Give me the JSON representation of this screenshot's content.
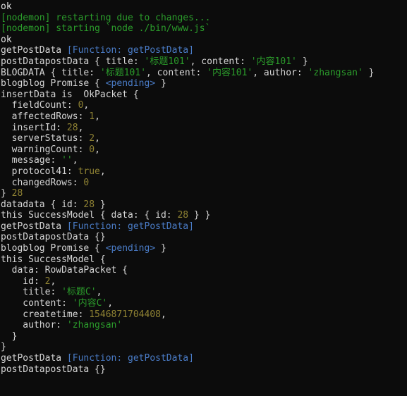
{
  "terminal": {
    "title": "node terminal output",
    "colors": {
      "background": "#0c0c0c",
      "default_text": "#d6d6d6",
      "string_green": "#2b9c2b",
      "function_blue": "#4a7cc7",
      "number_yellow": "#8f8233"
    },
    "lines": [
      {
        "id": "l01",
        "tokens": [
          {
            "t": "ok",
            "c": "white"
          }
        ]
      },
      {
        "id": "l02",
        "tokens": [
          {
            "t": "[nodemon] restarting due to changes...",
            "c": "green"
          }
        ]
      },
      {
        "id": "l03",
        "tokens": [
          {
            "t": "[nodemon] starting `node ./bin/www.js`",
            "c": "green"
          }
        ]
      },
      {
        "id": "l04",
        "tokens": [
          {
            "t": "ok",
            "c": "white"
          }
        ]
      },
      {
        "id": "l05",
        "tokens": [
          {
            "t": "getPostData ",
            "c": "default"
          },
          {
            "t": "[Function: getPostData]",
            "c": "blue"
          }
        ]
      },
      {
        "id": "l06",
        "tokens": [
          {
            "t": "postDatapostData { title: ",
            "c": "default"
          },
          {
            "t": "'标题101'",
            "c": "green"
          },
          {
            "t": ", content: ",
            "c": "default"
          },
          {
            "t": "'内容101'",
            "c": "green"
          },
          {
            "t": " }",
            "c": "default"
          }
        ]
      },
      {
        "id": "l07",
        "tokens": [
          {
            "t": "BLOGDATA { title: ",
            "c": "default"
          },
          {
            "t": "'标题101'",
            "c": "green"
          },
          {
            "t": ", content: ",
            "c": "default"
          },
          {
            "t": "'内容101'",
            "c": "green"
          },
          {
            "t": ", author: ",
            "c": "default"
          },
          {
            "t": "'zhangsan'",
            "c": "green"
          },
          {
            "t": " }",
            "c": "default"
          }
        ]
      },
      {
        "id": "l08",
        "tokens": [
          {
            "t": "blogblog Promise { ",
            "c": "default"
          },
          {
            "t": "<pending>",
            "c": "blue"
          },
          {
            "t": " }",
            "c": "default"
          }
        ]
      },
      {
        "id": "l09",
        "tokens": [
          {
            "t": "insertData is  OkPacket {",
            "c": "default"
          }
        ]
      },
      {
        "id": "l10",
        "tokens": [
          {
            "t": "  fieldCount: ",
            "c": "default"
          },
          {
            "t": "0",
            "c": "yellow"
          },
          {
            "t": ",",
            "c": "default"
          }
        ]
      },
      {
        "id": "l11",
        "tokens": [
          {
            "t": "  affectedRows: ",
            "c": "default"
          },
          {
            "t": "1",
            "c": "yellow"
          },
          {
            "t": ",",
            "c": "default"
          }
        ]
      },
      {
        "id": "l12",
        "tokens": [
          {
            "t": "  insertId: ",
            "c": "default"
          },
          {
            "t": "28",
            "c": "yellow"
          },
          {
            "t": ",",
            "c": "default"
          }
        ]
      },
      {
        "id": "l13",
        "tokens": [
          {
            "t": "  serverStatus: ",
            "c": "default"
          },
          {
            "t": "2",
            "c": "yellow"
          },
          {
            "t": ",",
            "c": "default"
          }
        ]
      },
      {
        "id": "l14",
        "tokens": [
          {
            "t": "  warningCount: ",
            "c": "default"
          },
          {
            "t": "0",
            "c": "yellow"
          },
          {
            "t": ",",
            "c": "default"
          }
        ]
      },
      {
        "id": "l15",
        "tokens": [
          {
            "t": "  message: ",
            "c": "default"
          },
          {
            "t": "''",
            "c": "green"
          },
          {
            "t": ",",
            "c": "default"
          }
        ]
      },
      {
        "id": "l16",
        "tokens": [
          {
            "t": "  protocol41: ",
            "c": "default"
          },
          {
            "t": "true",
            "c": "yellow"
          },
          {
            "t": ",",
            "c": "default"
          }
        ]
      },
      {
        "id": "l17",
        "tokens": [
          {
            "t": "  changedRows: ",
            "c": "default"
          },
          {
            "t": "0",
            "c": "yellow"
          }
        ]
      },
      {
        "id": "l18",
        "tokens": [
          {
            "t": "} ",
            "c": "default"
          },
          {
            "t": "28",
            "c": "yellow"
          }
        ]
      },
      {
        "id": "l19",
        "tokens": [
          {
            "t": "datadata { id: ",
            "c": "default"
          },
          {
            "t": "28",
            "c": "yellow"
          },
          {
            "t": " }",
            "c": "default"
          }
        ]
      },
      {
        "id": "l20",
        "tokens": [
          {
            "t": "this SuccessModel { data: { id: ",
            "c": "default"
          },
          {
            "t": "28",
            "c": "yellow"
          },
          {
            "t": " } }",
            "c": "default"
          }
        ]
      },
      {
        "id": "l21",
        "tokens": [
          {
            "t": "getPostData ",
            "c": "default"
          },
          {
            "t": "[Function: getPostData]",
            "c": "blue"
          }
        ]
      },
      {
        "id": "l22",
        "tokens": [
          {
            "t": "postDatapostData {}",
            "c": "default"
          }
        ]
      },
      {
        "id": "l23",
        "tokens": [
          {
            "t": "blogblog Promise { ",
            "c": "default"
          },
          {
            "t": "<pending>",
            "c": "blue"
          },
          {
            "t": " }",
            "c": "default"
          }
        ]
      },
      {
        "id": "l24",
        "tokens": [
          {
            "t": "this SuccessModel {",
            "c": "default"
          }
        ]
      },
      {
        "id": "l25",
        "tokens": [
          {
            "t": "  data: RowDataPacket {",
            "c": "default"
          }
        ]
      },
      {
        "id": "l26",
        "tokens": [
          {
            "t": "    id: ",
            "c": "default"
          },
          {
            "t": "2",
            "c": "yellow"
          },
          {
            "t": ",",
            "c": "default"
          }
        ]
      },
      {
        "id": "l27",
        "tokens": [
          {
            "t": "    title: ",
            "c": "default"
          },
          {
            "t": "'标题C'",
            "c": "green"
          },
          {
            "t": ",",
            "c": "default"
          }
        ]
      },
      {
        "id": "l28",
        "tokens": [
          {
            "t": "    content: ",
            "c": "default"
          },
          {
            "t": "'内容C'",
            "c": "green"
          },
          {
            "t": ",",
            "c": "default"
          }
        ]
      },
      {
        "id": "l29",
        "tokens": [
          {
            "t": "    createtime: ",
            "c": "default"
          },
          {
            "t": "1546871704408",
            "c": "yellow"
          },
          {
            "t": ",",
            "c": "default"
          }
        ]
      },
      {
        "id": "l30",
        "tokens": [
          {
            "t": "    author: ",
            "c": "default"
          },
          {
            "t": "'zhangsan'",
            "c": "green"
          }
        ]
      },
      {
        "id": "l31",
        "tokens": [
          {
            "t": "  }",
            "c": "default"
          }
        ]
      },
      {
        "id": "l32",
        "tokens": [
          {
            "t": "}",
            "c": "default"
          }
        ]
      },
      {
        "id": "l33",
        "tokens": [
          {
            "t": "getPostData ",
            "c": "default"
          },
          {
            "t": "[Function: getPostData]",
            "c": "blue"
          }
        ]
      },
      {
        "id": "l34",
        "tokens": [
          {
            "t": "postDatapostData {}",
            "c": "default"
          }
        ]
      }
    ]
  }
}
